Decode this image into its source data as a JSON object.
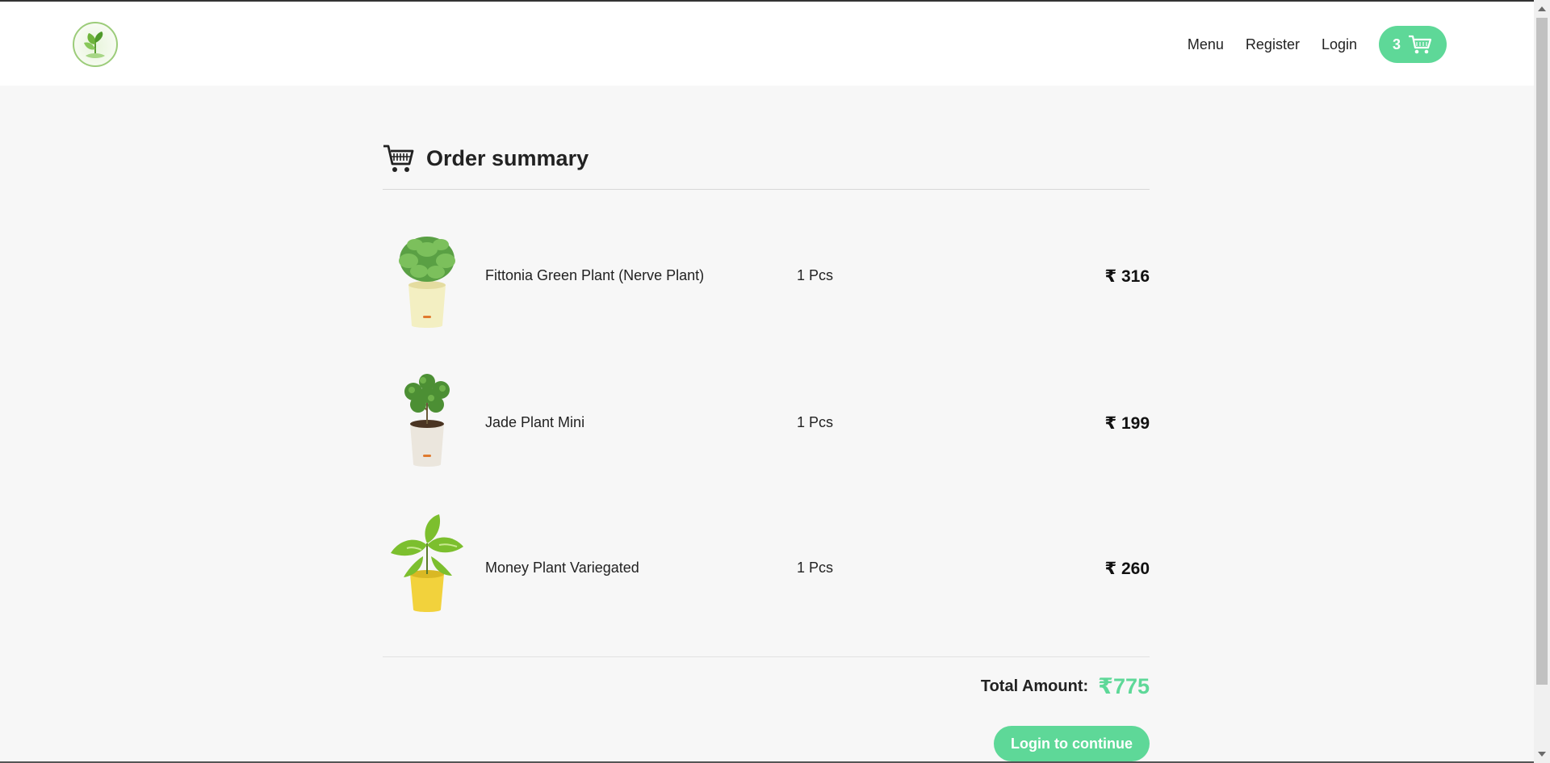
{
  "header": {
    "nav": [
      "Menu",
      "Register",
      "Login"
    ],
    "cart_count": "3"
  },
  "summary": {
    "title": "Order summary",
    "items": [
      {
        "name": "Fittonia Green Plant (Nerve Plant)",
        "qty": "1 Pcs",
        "price": "₹ 316",
        "pot_color": "#f3efc2"
      },
      {
        "name": "Jade Plant Mini",
        "qty": "1 Pcs",
        "price": "₹ 199",
        "pot_color": "#ebe6dd"
      },
      {
        "name": "Money Plant Variegated",
        "qty": "1 Pcs",
        "price": "₹ 260",
        "pot_color": "#f2d23c"
      }
    ],
    "total_label": "Total Amount:",
    "total_value": "₹775",
    "continue_label": "Login to continue"
  },
  "colors": {
    "accent": "#5ed898",
    "background": "#f7f7f7",
    "header_bg": "#ffffff"
  }
}
